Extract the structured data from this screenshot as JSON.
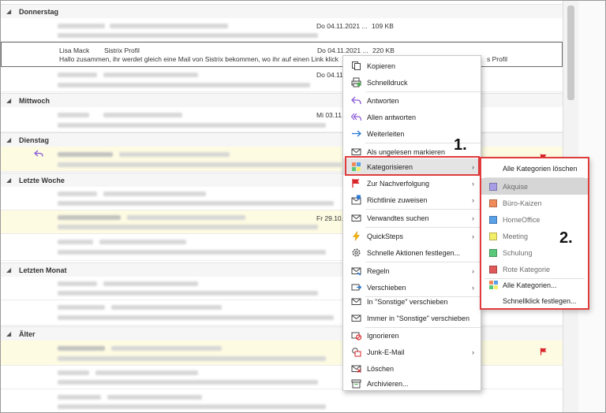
{
  "groups": {
    "donnerstag": "Donnerstag",
    "mittwoch": "Mittwoch",
    "dienstag": "Dienstag",
    "letzte_woche": "Letzte Woche",
    "letzten_monat": "Letzten Monat",
    "aelter": "Älter"
  },
  "rows": {
    "r1": {
      "date": "Do 04.11.2021 ...",
      "size": "109 KB"
    },
    "r2": {
      "sender": "Lisa Mack",
      "subject": "Sistrix Profil",
      "preview": "Hallo zusammen,  ihr werdet gleich eine Mail von Sistrix bekommen, wo ihr auf einen Link klick",
      "preview_tail": "s Profil",
      "date": "Do 04.11.2021 ...",
      "size": "220 KB"
    },
    "r3": {
      "date": "Do 04.11."
    },
    "r4": {
      "date": "Mi 03.11."
    },
    "r6": {
      "date": "Fr 29.10."
    }
  },
  "context_menu": {
    "items": [
      "Kopieren",
      "Schnelldruck",
      "Antworten",
      "Allen antworten",
      "Weiterleiten",
      "Als ungelesen markieren",
      "Kategorisieren",
      "Zur Nachverfolgung",
      "Richtlinie zuweisen",
      "Verwandtes suchen",
      "QuickSteps",
      "Schnelle Aktionen festlegen...",
      "Regeln",
      "Verschieben",
      "In \"Sonstige\" verschieben",
      "Immer in \"Sonstige\" verschieben",
      "Ignorieren",
      "Junk-E-Mail",
      "Löschen",
      "Archivieren..."
    ]
  },
  "submenu": {
    "clear_all": "Alle Kategorien löschen",
    "categories": [
      {
        "label": "Akquise",
        "color": "#a79ee6"
      },
      {
        "label": "Büro-Kaizen",
        "color": "#f08a5a"
      },
      {
        "label": "HomeOffice",
        "color": "#5aa0e6"
      },
      {
        "label": "Meeting",
        "color": "#f3ee6a"
      },
      {
        "label": "Schulung",
        "color": "#5ac87a"
      },
      {
        "label": "Rote Kategorie",
        "color": "#e05a5a"
      }
    ],
    "all_categories": "Alle Kategorien...",
    "quick_click": "Schnellklick festlegen..."
  },
  "callouts": {
    "one": "1.",
    "two": "2."
  },
  "colors": {
    "highlight_border": "#e03c3c",
    "flag": "#d9262b"
  }
}
